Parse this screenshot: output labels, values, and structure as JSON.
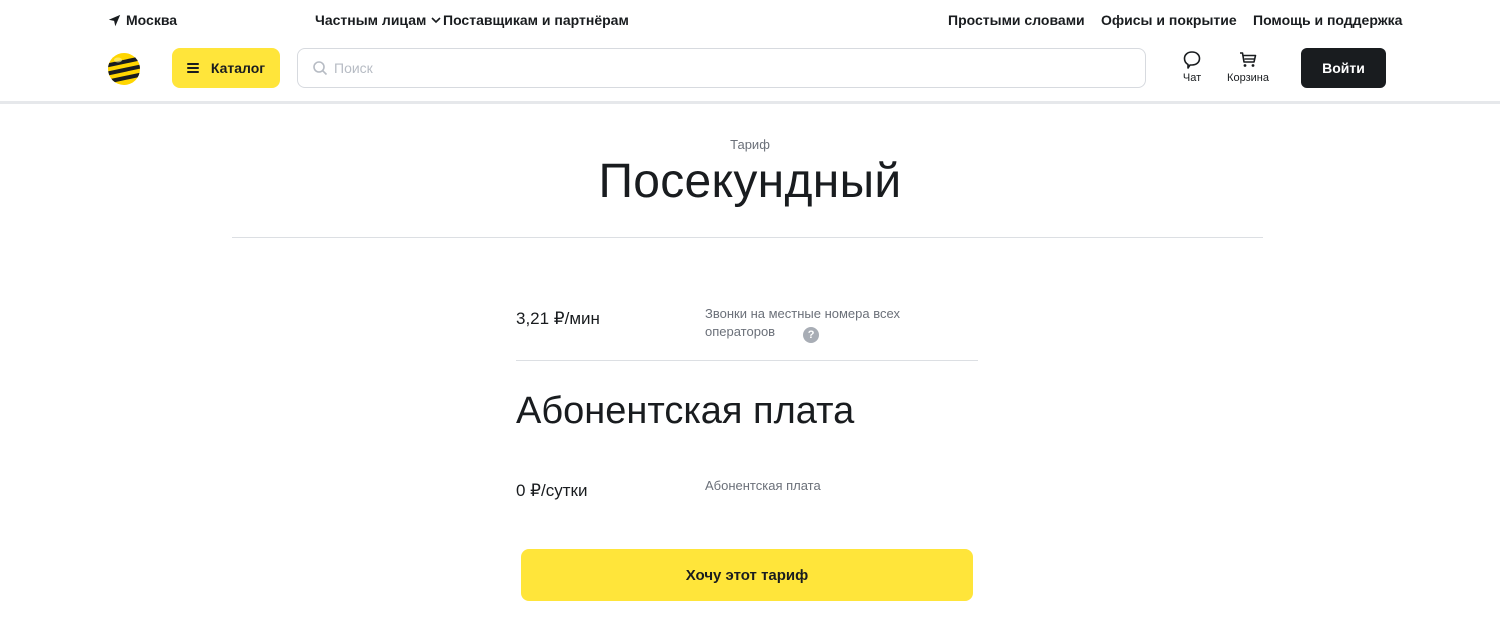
{
  "topbar": {
    "city": "Москва",
    "segments": [
      {
        "label": "Частным лицам",
        "has_dropdown": true
      },
      {
        "label": "Поставщикам и партнёрам"
      }
    ],
    "links": [
      "Простыми словами",
      "Офисы и покрытие",
      "Помощь и поддержка"
    ]
  },
  "header": {
    "catalog_label": "Каталог",
    "search_placeholder": "Поиск",
    "chat_label": "Чат",
    "cart_label": "Корзина",
    "login_label": "Войти",
    "brand_colors": {
      "yellow": "#ffe53a",
      "dark": "#191c1f"
    }
  },
  "tariff": {
    "kicker": "Тариф",
    "name": "Посекундный",
    "call_price": "3,21 ₽/мин",
    "call_desc": "Звонки на местные номера всех операторов",
    "help_icon": "?",
    "fee_section_title": "Абонентская плата",
    "fee_price": "0 ₽/сутки",
    "fee_desc": "Абонентская плата",
    "cta_label": "Хочу этот тариф"
  }
}
